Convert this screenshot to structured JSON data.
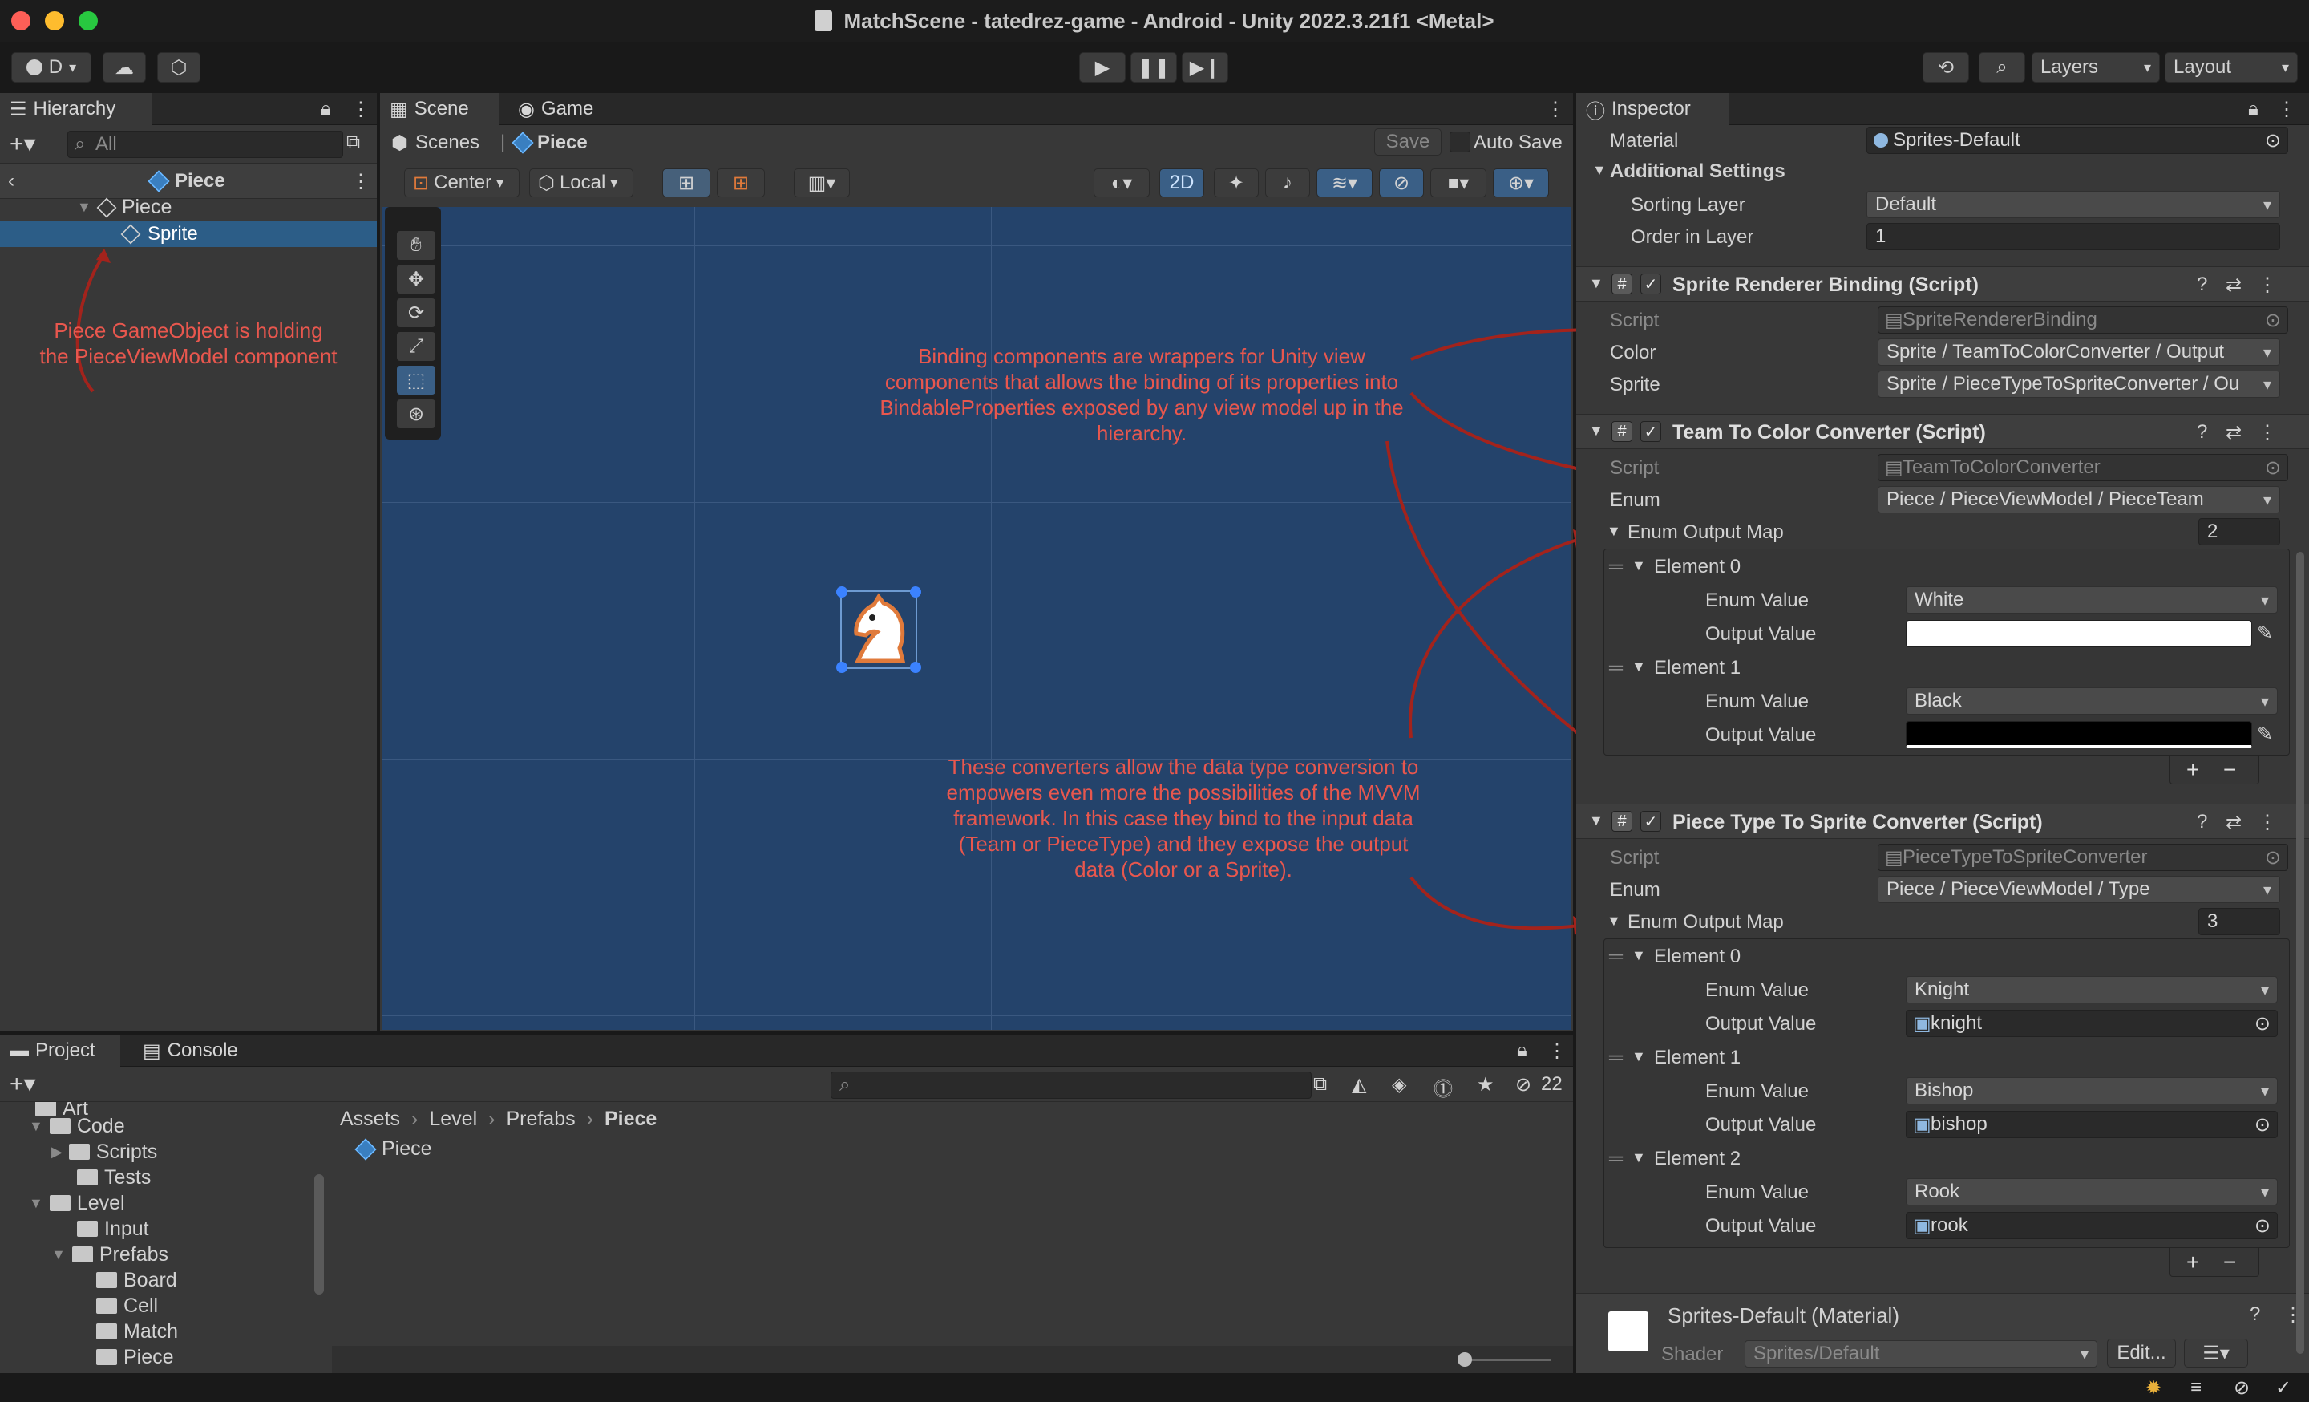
{
  "window": {
    "title": "MatchScene - tatedrez-game - Android - Unity 2022.3.21f1 <Metal>"
  },
  "toolbar": {
    "account": "D",
    "layers": "Layers",
    "layout": "Layout"
  },
  "hierarchy": {
    "tab": "Hierarchy",
    "search_placeholder": "All",
    "breadcrumb": "Piece",
    "items": [
      {
        "label": "Piece"
      },
      {
        "label": "Sprite"
      }
    ]
  },
  "scene": {
    "tabs": [
      "Scene",
      "Game"
    ],
    "crumb_root": "Scenes",
    "crumb_current": "Piece",
    "save": "Save",
    "auto_save": "Auto Save",
    "pivot": "Center",
    "space": "Local",
    "mode2d": "2D"
  },
  "annotations": {
    "hierarchy_note": "Piece GameObject is holding\nthe PieceViewModel component",
    "binding_note": "Binding components are wrappers for Unity view\ncomponents that allows the binding of its properties into\nBindableProperties exposed by any view model up in the\nhierarchy.",
    "converter_note": "These converters allow the data type conversion to\nempowers even more the possibilities of the MVVM\nframework. In this case they bind to the input data\n(Team or PieceType) and they expose the output\ndata (Color or a Sprite)."
  },
  "inspector": {
    "tab": "Inspector",
    "material_label": "Material",
    "material_value": "Sprites-Default",
    "additional_settings": "Additional Settings",
    "sorting_layer_label": "Sorting Layer",
    "sorting_layer_value": "Default",
    "order_label": "Order in Layer",
    "order_value": "1",
    "binding": {
      "title": "Sprite Renderer Binding (Script)",
      "script_label": "Script",
      "script_value": "SpriteRendererBinding",
      "color_label": "Color",
      "color_value": "Sprite / TeamToColorConverter / Output",
      "sprite_label": "Sprite",
      "sprite_value": "Sprite / PieceTypeToSpriteConverter / Ou"
    },
    "team": {
      "title": "Team To Color Converter (Script)",
      "script_label": "Script",
      "script_value": "TeamToColorConverter",
      "enum_label": "Enum",
      "enum_value": "Piece / PieceViewModel / PieceTeam",
      "map_label": "Enum Output Map",
      "map_count": "2",
      "e0": "Element 0",
      "e0_enum": "White",
      "e1": "Element 1",
      "e1_enum": "Black",
      "enum_value_label": "Enum Value",
      "output_value_label": "Output Value",
      "color_white": "#ffffff",
      "color_black": "#000000"
    },
    "piece": {
      "title": "Piece Type To Sprite Converter (Script)",
      "script_label": "Script",
      "script_value": "PieceTypeToSpriteConverter",
      "enum_label": "Enum",
      "enum_value": "Piece / PieceViewModel / Type",
      "map_label": "Enum Output Map",
      "map_count": "3",
      "e0": "Element 0",
      "e0_enum": "Knight",
      "e0_out": "knight",
      "e1": "Element 1",
      "e1_enum": "Bishop",
      "e1_out": "bishop",
      "e2": "Element 2",
      "e2_enum": "Rook",
      "e2_out": "rook",
      "enum_value_label": "Enum Value",
      "output_value_label": "Output Value"
    },
    "material_footer": {
      "title": "Sprites-Default (Material)",
      "shader_label": "Shader",
      "shader_value": "Sprites/Default",
      "edit": "Edit..."
    }
  },
  "project": {
    "tabs": [
      "Project",
      "Console"
    ],
    "hidden_count": "22",
    "breadcrumb": [
      "Assets",
      "Level",
      "Prefabs",
      "Piece"
    ],
    "asset": "Piece",
    "tree": [
      {
        "label": "Art"
      },
      {
        "label": "Code"
      },
      {
        "label": "Scripts"
      },
      {
        "label": "Tests"
      },
      {
        "label": "Level"
      },
      {
        "label": "Input"
      },
      {
        "label": "Prefabs"
      },
      {
        "label": "Board"
      },
      {
        "label": "Cell"
      },
      {
        "label": "Match"
      },
      {
        "label": "Piece"
      }
    ]
  }
}
